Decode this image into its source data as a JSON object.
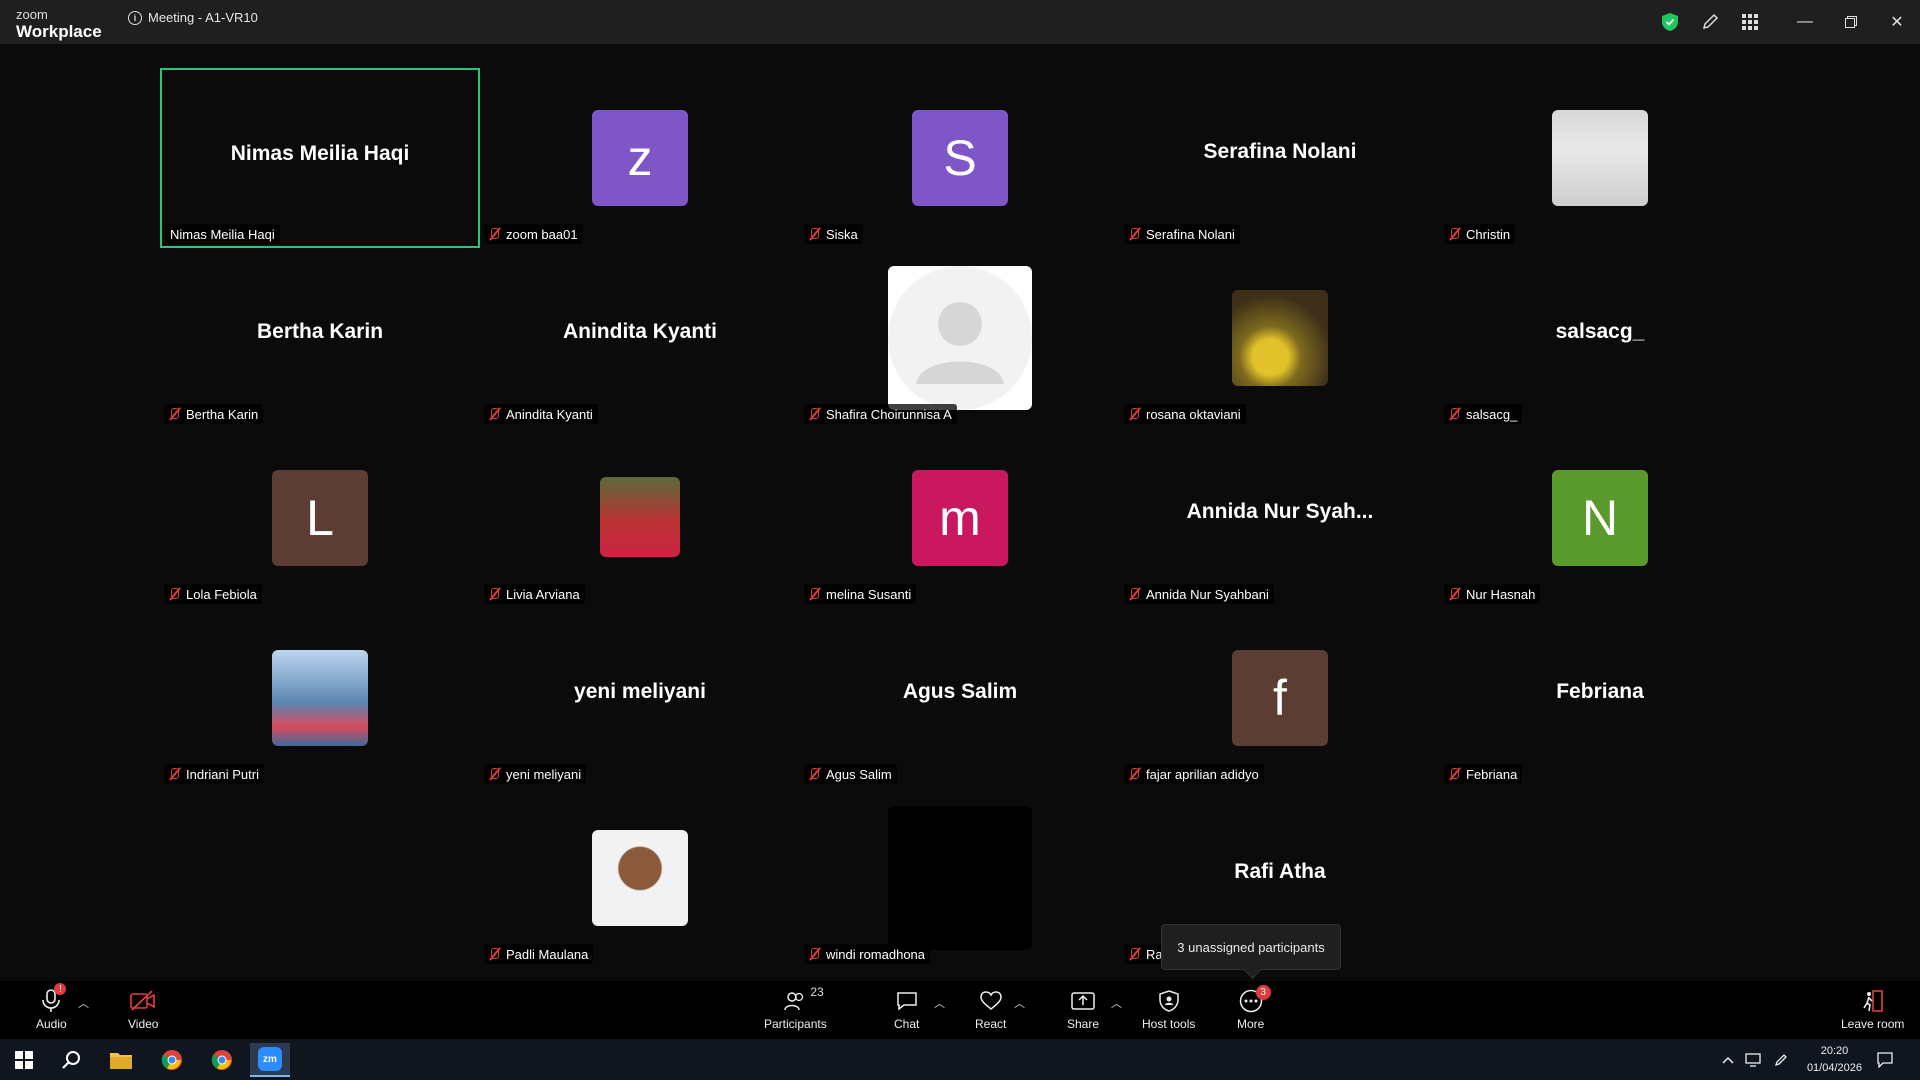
{
  "titlebar": {
    "logo_top": "zoom",
    "logo_bottom": "Workplace",
    "meeting_title": "Meeting - A1-VR10"
  },
  "participants": [
    {
      "display": "Nimas Meilia Haqi",
      "tag": "Nimas Meilia Haqi",
      "kind": "name",
      "muted": false
    },
    {
      "display": "z",
      "tag": "zoom baa01",
      "kind": "letter",
      "color": "#7f56c8",
      "muted": true
    },
    {
      "display": "S",
      "tag": "Siska",
      "kind": "letter",
      "color": "#7f56c8",
      "muted": true
    },
    {
      "display": "Serafina Nolani",
      "tag": "Serafina Nolani",
      "kind": "name",
      "muted": true
    },
    {
      "display": "",
      "tag": "Christin",
      "kind": "photo",
      "muted": true
    },
    {
      "display": "Bertha Karin",
      "tag": "Bertha Karin",
      "kind": "name",
      "muted": true
    },
    {
      "display": "Anindita Kyanti",
      "tag": "Anindita Kyanti",
      "kind": "name",
      "muted": true
    },
    {
      "display": "",
      "tag": "Shafira Choirunnisa A",
      "kind": "default",
      "muted": true
    },
    {
      "display": "",
      "tag": "rosana oktaviani",
      "kind": "photo",
      "muted": true
    },
    {
      "display": "salsacg_",
      "tag": "salsacg_",
      "kind": "name",
      "muted": true
    },
    {
      "display": "L",
      "tag": "Lola Febiola",
      "kind": "letter",
      "color": "#5b3d33",
      "muted": true
    },
    {
      "display": "",
      "tag": "Livia Arviana",
      "kind": "photo",
      "muted": true
    },
    {
      "display": "m",
      "tag": "melina Susanti",
      "kind": "letter",
      "color": "#c9185e",
      "muted": true
    },
    {
      "display": "Annida  Nur  Syah...",
      "tag": "Annida Nur Syahbani",
      "kind": "name",
      "muted": true
    },
    {
      "display": "N",
      "tag": "Nur Hasnah",
      "kind": "letter",
      "color": "#5a9a2c",
      "muted": true
    },
    {
      "display": "",
      "tag": "Indriani Putri",
      "kind": "photo",
      "muted": true
    },
    {
      "display": "yeni meliyani",
      "tag": "yeni meliyani",
      "kind": "name",
      "muted": true
    },
    {
      "display": "Agus Salim",
      "tag": "Agus Salim",
      "kind": "name",
      "muted": true
    },
    {
      "display": "f",
      "tag": "fajar aprilian adidyo",
      "kind": "letter",
      "color": "#5b3d33",
      "muted": true
    },
    {
      "display": "Febriana",
      "tag": "Febriana",
      "kind": "name",
      "muted": true
    },
    {
      "display": "",
      "tag": "Padli Maulana",
      "kind": "photo",
      "muted": true
    },
    {
      "display": "",
      "tag": "windi romadhona",
      "kind": "black",
      "muted": true
    },
    {
      "display": "Rafi Atha",
      "tag": "Raf",
      "kind": "name",
      "muted": true
    }
  ],
  "tooltip": "3 unassigned participants",
  "toolbar": {
    "audio": "Audio",
    "video": "Video",
    "participants": "Participants",
    "participants_count": "23",
    "chat": "Chat",
    "react": "React",
    "share": "Share",
    "host_tools": "Host tools",
    "more": "More",
    "more_badge": "3",
    "leave": "Leave room"
  },
  "taskbar": {
    "time": "20:20",
    "date": "01/04/2026"
  },
  "colors": {
    "active_border": "#2ec27e",
    "muted_red": "#e03e3e",
    "badge_red": "#e0393e"
  }
}
